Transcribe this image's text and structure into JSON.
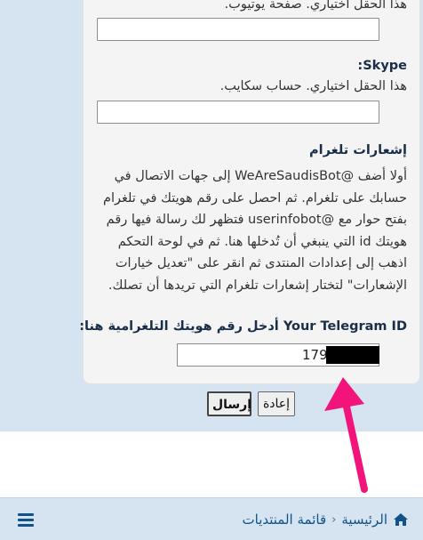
{
  "form": {
    "youtube_hint": "هذا الحقل اختياري. صفحة يوتيوب.",
    "skype_label": "Skype:",
    "skype_hint": "هذا الحقل اختياري. حساب سكايب.",
    "telegram_section_title": "إشعارات تلغرام",
    "telegram_instructions": [
      "أولا أضف @WeAreSaudisBot إلى جهات الاتصال في",
      "حسابك على تلغرام. ثم احصل على رقم هويتك في تلغرام",
      "بفتح حوار مع @userinfobot فتظهر لك رسالة فيها رقم",
      "هويتك id التي ينبغي أن تُدخلها هنا. ثم في لوحة التحكم",
      "اذهب إلى إعدادات المنتدى ثم انقر على \"تعديل خيارات",
      "الإشعارات\" لتختار إشعارات تلغرام التي تريدها أن تصلك."
    ],
    "telegram_id_label": "Your Telegram ID أدخل رقم هويتك التلغرامية هنا:",
    "telegram_id_value": "179",
    "submit_label": "إرسال",
    "reset_label": "إعادة"
  },
  "navbar": {
    "home_label": "الرئيسية",
    "separator": "‹",
    "forums_label": "قائمة المنتديات"
  },
  "icons": {
    "home": "home-icon",
    "menu": "hamburger-menu-icon",
    "annotation": "arrow-annotation-icon"
  },
  "colors": {
    "page_bg": "#d6e3f1",
    "panel_bg": "#f4f4f4",
    "link": "#105289",
    "arrow": "#f2147a"
  }
}
